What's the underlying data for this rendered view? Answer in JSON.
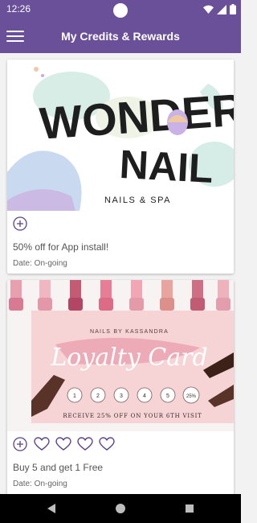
{
  "status_bar": {
    "time": "12:26",
    "icons": [
      "wifi-icon",
      "signal-icon",
      "battery-icon"
    ]
  },
  "app_bar": {
    "title": "My Credits & Rewards",
    "menu_icon": "hamburger-menu-icon"
  },
  "cards": [
    {
      "image": {
        "brand_line1": "WONDER",
        "brand_line2": "NAIL",
        "tagline": "NAILS & SPA"
      },
      "action_icons": [
        "add-circle-icon"
      ],
      "title": "50% off for App install!",
      "date": "Date: On-going"
    },
    {
      "image": {
        "header": "NAILS BY KASSANDRA",
        "card_title": "Loyalty Card",
        "stamps": [
          "1",
          "2",
          "3",
          "4",
          "5",
          "25%"
        ],
        "offer": "RECEIVE 25% OFF ON YOUR 6TH VISIT"
      },
      "action_icons": [
        "add-circle-icon",
        "heart-outline-icon",
        "heart-outline-icon",
        "heart-outline-icon",
        "heart-outline-icon"
      ],
      "title": "Buy 5 and get 1 Free",
      "date": "Date: On-going"
    }
  ],
  "nav_bar": {
    "icons": [
      "back-icon",
      "home-icon",
      "recents-icon"
    ]
  },
  "colors": {
    "primary": "#6a4f99",
    "icon_purple": "#5b3f8c",
    "nav_bg": "#000000"
  }
}
